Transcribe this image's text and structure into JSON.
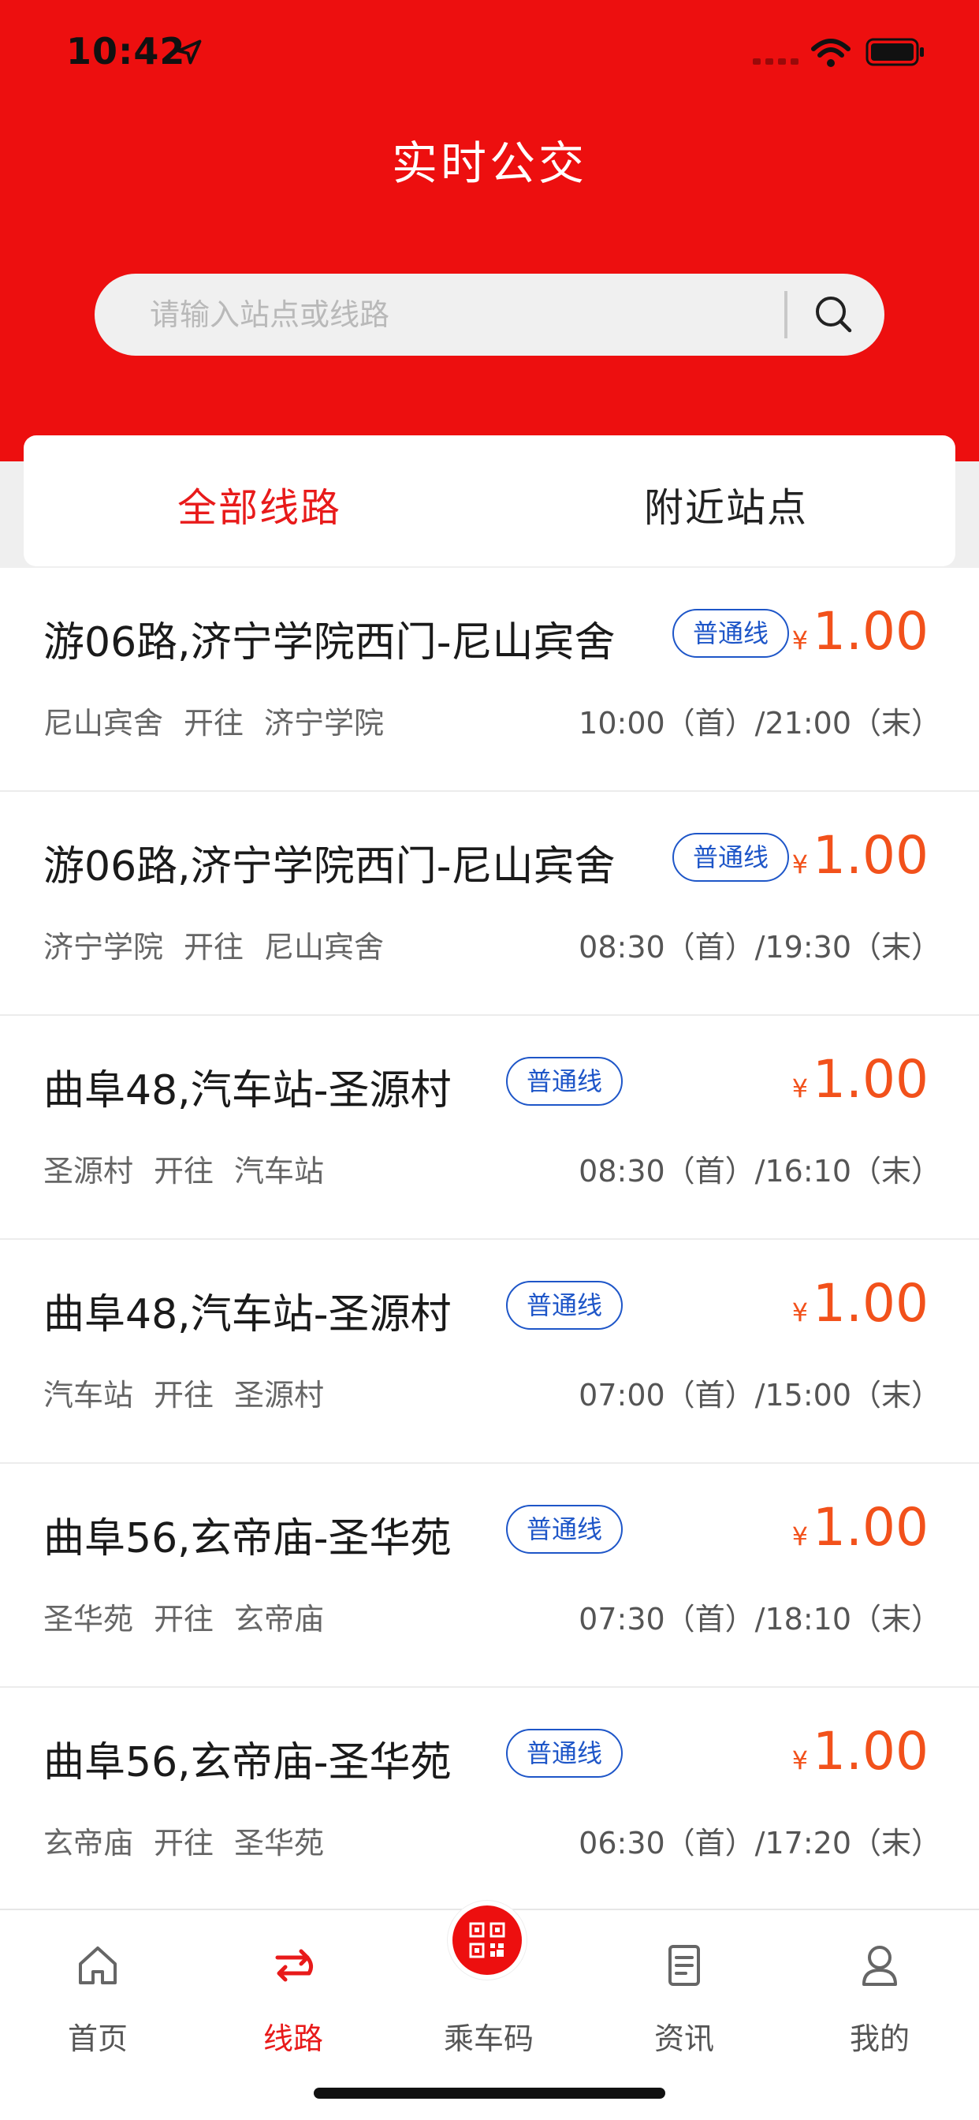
{
  "status_bar": {
    "time": "10:42"
  },
  "header": {
    "title": "实时公交"
  },
  "search": {
    "placeholder": "请输入站点或线路"
  },
  "tabs": [
    {
      "label": "全部线路",
      "active": true
    },
    {
      "label": "附近站点",
      "active": false
    }
  ],
  "routes": [
    {
      "name": "游06路,济宁学院西门-尼山宾舍",
      "badge": "普通线",
      "yen": "¥",
      "price": "1.00",
      "from": "尼山宾舍",
      "dir": "开往",
      "to": "济宁学院",
      "hours": "10:00（首）/21:00（末）"
    },
    {
      "name": "游06路,济宁学院西门-尼山宾舍",
      "badge": "普通线",
      "yen": "¥",
      "price": "1.00",
      "from": "济宁学院",
      "dir": "开往",
      "to": "尼山宾舍",
      "hours": "08:30（首）/19:30（末）"
    },
    {
      "name": "曲阜48,汽车站-圣源村",
      "badge": "普通线",
      "yen": "¥",
      "price": "1.00",
      "from": "圣源村",
      "dir": "开往",
      "to": "汽车站",
      "hours": "08:30（首）/16:10（末）"
    },
    {
      "name": "曲阜48,汽车站-圣源村",
      "badge": "普通线",
      "yen": "¥",
      "price": "1.00",
      "from": "汽车站",
      "dir": "开往",
      "to": "圣源村",
      "hours": "07:00（首）/15:00（末）"
    },
    {
      "name": "曲阜56,玄帝庙-圣华苑",
      "badge": "普通线",
      "yen": "¥",
      "price": "1.00",
      "from": "圣华苑",
      "dir": "开往",
      "to": "玄帝庙",
      "hours": "07:30（首）/18:10（末）"
    },
    {
      "name": "曲阜56,玄帝庙-圣华苑",
      "badge": "普通线",
      "yen": "¥",
      "price": "1.00",
      "from": "玄帝庙",
      "dir": "开往",
      "to": "圣华苑",
      "hours": "06:30（首）/17:20（末）"
    }
  ],
  "nav": [
    {
      "label": "首页",
      "icon": "home-icon",
      "active": false
    },
    {
      "label": "线路",
      "icon": "route-icon",
      "active": true
    },
    {
      "label": "乘车码",
      "icon": "qr-code-icon",
      "active": false
    },
    {
      "label": "资讯",
      "icon": "news-icon",
      "active": false
    },
    {
      "label": "我的",
      "icon": "profile-icon",
      "active": false
    }
  ],
  "colors": {
    "header_red": "#ed0f0f",
    "active_red": "#e81a1a",
    "price_orange": "#f2511b",
    "badge_blue": "#1e56c8"
  }
}
